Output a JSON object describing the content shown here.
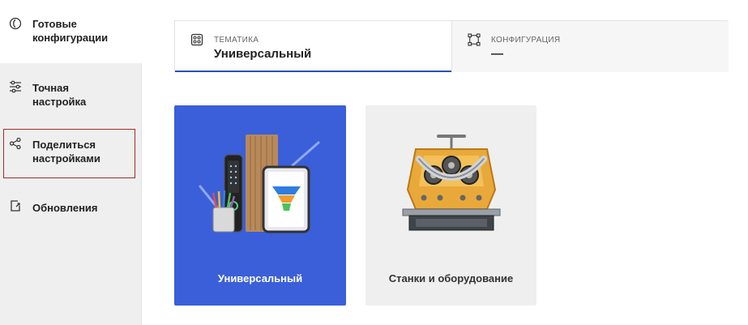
{
  "sidebar": {
    "items": [
      {
        "label_line1": "Готовые",
        "label_line2": "конфигурации",
        "icon": "circle-swirl-icon"
      },
      {
        "label_line1": "Точная",
        "label_line2": "настройка",
        "icon": "sliders-icon"
      },
      {
        "label_line1": "Поделиться",
        "label_line2": "настройками",
        "icon": "share-icon"
      },
      {
        "label_line1": "Обновления",
        "label_line2": "",
        "icon": "update-icon"
      }
    ]
  },
  "tabs": [
    {
      "caption": "Тематика",
      "value": "Универсальный",
      "icon": "theme-icon"
    },
    {
      "caption": "Конфигурация",
      "value": "—",
      "icon": "config-icon"
    }
  ],
  "cards": [
    {
      "label": "Универсальный",
      "color": "#3a5fd9"
    },
    {
      "label": "Станки и оборудование",
      "color": "#efefef"
    }
  ],
  "colors": {
    "accent": "#2c4fb8",
    "highlight_border": "#a52a2a"
  }
}
